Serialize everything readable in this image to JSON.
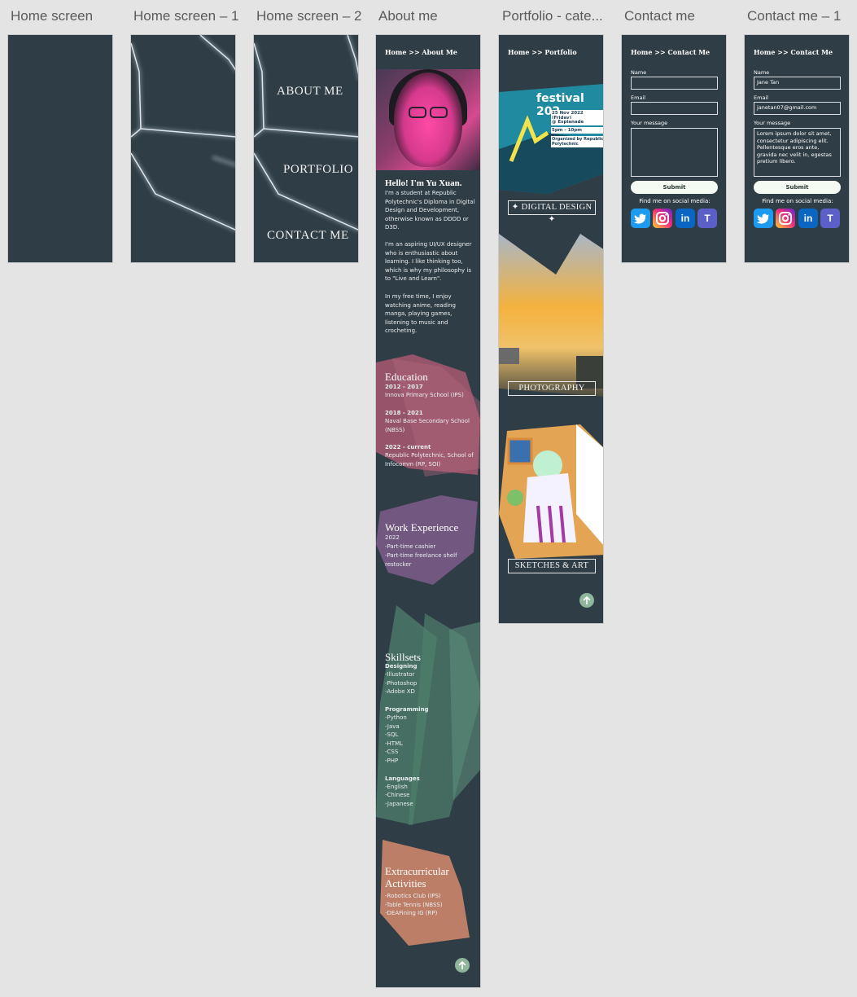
{
  "frames": [
    {
      "label": "Home screen"
    },
    {
      "label": "Home screen – 1"
    },
    {
      "label": "Home screen – 2"
    },
    {
      "label": "About me"
    },
    {
      "label": "Portfolio - cate..."
    },
    {
      "label": "Contact me"
    },
    {
      "label": "Contact me – 1"
    }
  ],
  "home2": {
    "about": "ABOUT ME",
    "portfolio": "PORTFOLIO",
    "contact": "CONTACT ME"
  },
  "about": {
    "breadcrumb": "Home >> About Me",
    "hello": "Hello! I'm Yu Xuan.",
    "intro1": "I'm a student at Republic Polytechnic's Diploma in Digital Design and Development, otherwise known as DDDD or D3D.",
    "intro2": "I'm an aspiring UI/UX designer who is enthusiastic about learning. I like thinking too, which is why my philosophy is to \"Live and Learn\".",
    "intro3": "In my free time, I enjoy watching anime, reading manga, playing games, listening to music and crocheting.",
    "education": {
      "title": "Education",
      "items": [
        {
          "years": "2012 - 2017",
          "school": "Innova Primary School (IPS)"
        },
        {
          "years": "2018 - 2021",
          "school": "Naval Base Secondary School (NBSS)"
        },
        {
          "years": "2022 - current",
          "school": "Republic Polytechnic, School of Infocomm (RP, SOI)"
        }
      ]
    },
    "work": {
      "title": "Work Experience",
      "year": "2022",
      "items": [
        "-Part-time cashier",
        "-Part-time freelance shelf restocker"
      ]
    },
    "skills": {
      "title": "Skillsets",
      "designing": {
        "title": "Designing",
        "items": [
          "-Illustrator",
          "-Photoshop",
          "-Adobe XD"
        ]
      },
      "programming": {
        "title": "Programming",
        "items": [
          "-Python",
          "-Java",
          "-SQL",
          "-HTML",
          "-CSS",
          "-PHP"
        ]
      },
      "languages": {
        "title": "Languages",
        "items": [
          "-English",
          "-Chinese",
          "-Japanese"
        ]
      }
    },
    "extra": {
      "title": "Extracurricular Activities",
      "items": [
        "-Robotics Club (IPS)",
        "-Table Tennis (NBSS)",
        "-DEAFining IG (RP)"
      ]
    }
  },
  "portfolio": {
    "breadcrumb": "Home >> Portfolio",
    "poster": {
      "title": "festival 202",
      "date": "25 Nov 2022 (Friday)",
      "venue": "@ Esplanade",
      "time": "5pm - 10pm",
      "org": "Organized by Republic Polytechnic"
    },
    "digital": "✦ DIGITAL DESIGN ✦",
    "photography": "PHOTOGRAPHY",
    "sketches": "SKETCHES & ART"
  },
  "contact": {
    "breadcrumb": "Home >> Contact Me",
    "name_label": "Name",
    "email_label": "Email",
    "message_label": "Your message",
    "submit": "Submit",
    "social_caption": "Find me on social media:",
    "filled_name": "Jane Tan",
    "filled_email": "janetan07@gmail.com",
    "filled_message": "Lorem ipsum dolor sit amet, consectetur adipiscing elit. Pellentesque eros ante, gravida nec velit in, egestas pretium libero."
  },
  "colors": {
    "frame_bg": "#2f3d46",
    "edu": "#a2566e",
    "work": "#7a5a86",
    "skills": "#4f7f6c",
    "extra": "#d58a6d",
    "btn": "#8fb59a"
  },
  "icons": [
    "twitter-icon",
    "instagram-icon",
    "linkedin-icon",
    "teams-icon",
    "arrow-up-icon"
  ]
}
